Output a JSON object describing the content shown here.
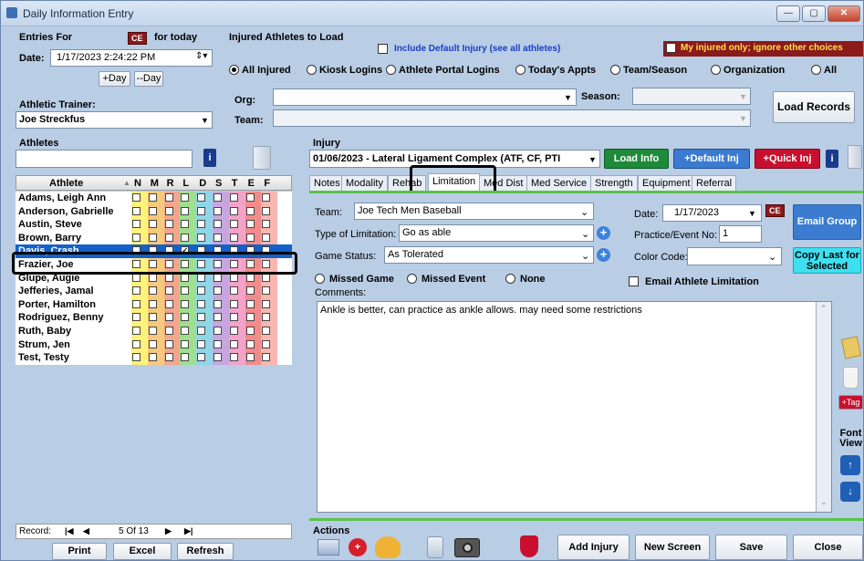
{
  "window": {
    "title": "Daily Information Entry"
  },
  "entries": {
    "label": "Entries For",
    "ce": "CE",
    "for_today": "for today",
    "date_label": "Date:",
    "date_value": "1/17/2023  2:24:22 PM",
    "plus_day": "+Day",
    "minus_day": "--Day"
  },
  "trainer": {
    "label": "Athletic Trainer:",
    "value": "Joe Streckfus"
  },
  "injured": {
    "label": "Injured Athletes to Load",
    "include_default": "Include Default Injury (see all athletes)",
    "my_injured": "My injured only; ignore other choices",
    "radios": [
      "All Injured",
      "Kiosk Logins",
      "Athlete Portal Logins",
      "Today's Appts",
      "Team/Season",
      "Organization",
      "All"
    ],
    "org_label": "Org:",
    "season_label": "Season:",
    "team_label": "Team:",
    "load_records": "Load Records"
  },
  "athletes": {
    "label": "Athletes",
    "col_athlete": "Athlete",
    "columns": [
      "N",
      "M",
      "R",
      "L",
      "D",
      "S",
      "T",
      "E",
      "F"
    ],
    "column_colors": [
      "#fff27a",
      "#f7c97a",
      "#f2a68e",
      "#9fe08f",
      "#8fd6e8",
      "#c7a6e0",
      "#f3a2c8",
      "#f28b8b",
      "#f7b7b0"
    ],
    "rows": [
      {
        "name": "Adams, Leigh Ann"
      },
      {
        "name": "Anderson, Gabrielle"
      },
      {
        "name": "Austin, Steve"
      },
      {
        "name": "Brown, Barry"
      },
      {
        "name": "Davis, Crash",
        "selected": true
      },
      {
        "name": "Frazier, Joe"
      },
      {
        "name": "Glupe, Augie"
      },
      {
        "name": "Jefferies, Jamal"
      },
      {
        "name": "Porter, Hamilton"
      },
      {
        "name": "Rodriguez, Benny"
      },
      {
        "name": "Ruth, Baby"
      },
      {
        "name": "Strum, Jen"
      },
      {
        "name": "Test, Testy"
      }
    ],
    "record_label": "Record:",
    "record_value": "5 Of  13"
  },
  "bottom_left": {
    "print": "Print",
    "excel": "Excel",
    "refresh": "Refresh"
  },
  "injury": {
    "label": "Injury",
    "value": "01/06/2023 - Lateral Ligament Complex (ATF, CF, PTI",
    "load_info": "Load Info",
    "default_inj": "+Default Inj",
    "quick_inj": "+Quick Inj"
  },
  "tabs": [
    "Notes",
    "Modality",
    "Rehab",
    "Limitation",
    "Med Dist",
    "Med Service",
    "Strength",
    "Equipment",
    "Referral"
  ],
  "limitation": {
    "team_label": "Team:",
    "team_value": "Joe Tech Men Baseball",
    "date_label": "Date:",
    "date_value": "1/17/2023",
    "ce": "CE",
    "type_label": "Type of Limitation:",
    "type_value": "Go as able",
    "practice_label": "Practice/Event No:",
    "practice_value": "1",
    "game_label": "Game Status:",
    "game_value": "As Tolerated",
    "color_label": "Color Code:",
    "color_value": "",
    "missed_game": "Missed Game",
    "missed_event": "Missed Event",
    "none": "None",
    "email_limit": "Email Athlete Limitation",
    "comments_label": "Comments:",
    "comments_value": "Ankle is better, can practice as ankle allows. may need some restrictions",
    "email_group": "Email Group",
    "copy_last": "Copy Last for Selected",
    "tag": "+Tag",
    "font_view": "Font View"
  },
  "actions": {
    "label": "Actions",
    "add_injury": "Add Injury",
    "new_screen": "New Screen",
    "save": "Save",
    "close": "Close"
  }
}
